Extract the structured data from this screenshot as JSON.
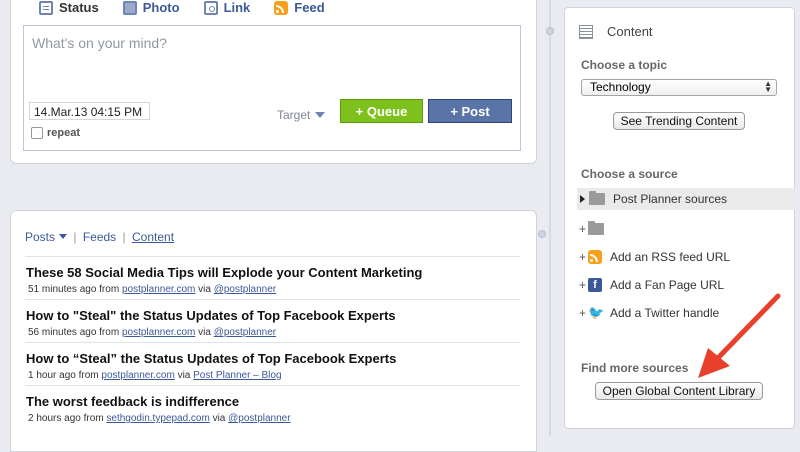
{
  "composer": {
    "tabs": [
      {
        "label": "Status",
        "icon": "status-icon"
      },
      {
        "label": "Photo",
        "icon": "photo-icon"
      },
      {
        "label": "Link",
        "icon": "link-icon"
      },
      {
        "label": "Feed",
        "icon": "rss-icon"
      }
    ],
    "placeholder": "What's on your mind?",
    "date_value": "14.Mar.13 04:15 PM",
    "target_label": "Target",
    "queue_label": "+ Queue",
    "post_label": "+ Post",
    "repeat_label": "repeat"
  },
  "feed": {
    "tabs": {
      "posts": "Posts",
      "feeds": "Feeds",
      "content": "Content"
    },
    "posts": [
      {
        "title": "These 58 Social Media Tips will Explode your Content Marketing",
        "time": "51 minutes ago from",
        "source": "postplanner.com",
        "via": "via",
        "via_link": "@postplanner"
      },
      {
        "title": "How to \"Steal\" the Status Updates of Top Facebook Experts",
        "time": "56 minutes ago from",
        "source": "postplanner.com",
        "via": "via",
        "via_link": "@postplanner"
      },
      {
        "title": "How to “Steal” the Status Updates of Top Facebook Experts",
        "time": "1 hour ago from",
        "source": "postplanner.com",
        "via": "via",
        "via_link": "Post Planner – Blog"
      },
      {
        "title": "The worst feedback is indifference",
        "time": "2 hours ago from",
        "source": "sethgodin.typepad.com",
        "via": "via",
        "via_link": "@postplanner"
      }
    ]
  },
  "content_panel": {
    "title": "Content",
    "topic_label": "Choose a topic",
    "topic_value": "Technology",
    "trending_button": "See Trending Content",
    "source_label": "Choose a source",
    "sources": {
      "post_planner": "Post Planner sources",
      "rss": "Add an RSS feed URL",
      "fan_page": "Add a Fan Page URL",
      "twitter": "Add a Twitter handle"
    },
    "more_label": "Find more sources",
    "library_button": "Open Global Content Library"
  },
  "colors": {
    "queue": "#7ec11d",
    "post": "#5b74a8",
    "link": "#3b5998",
    "annotation_arrow": "#e8402a"
  }
}
